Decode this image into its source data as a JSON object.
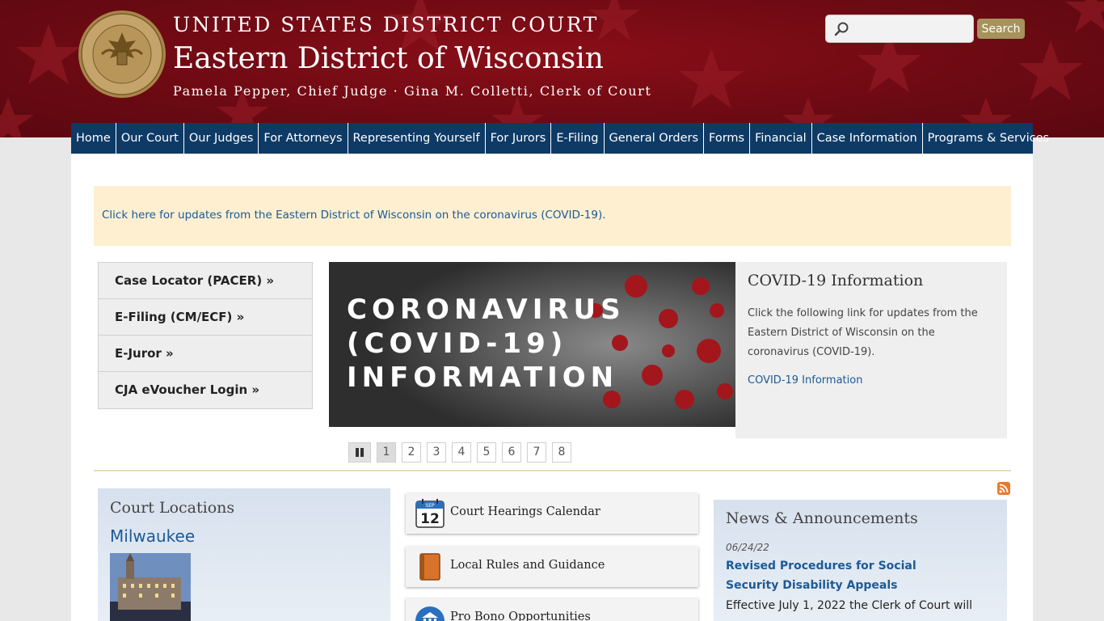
{
  "header": {
    "court": "UNITED STATES DISTRICT COURT",
    "district": "Eastern District of Wisconsin",
    "officers": "Pamela Pepper, Chief Judge · Gina M. Colletti, Clerk of Court",
    "seal_icon": "court-seal"
  },
  "search": {
    "placeholder": "",
    "value": "",
    "button_label": "Search"
  },
  "nav": {
    "items": [
      "Home",
      "Our Court",
      "Our Judges",
      "For Attorneys",
      "Representing Yourself",
      "For Jurors",
      "E-Filing",
      "General Orders",
      "Forms",
      "Financial",
      "Case Information",
      "Programs & Services"
    ]
  },
  "alert": {
    "link_text": "Click here for updates from the Eastern District of Wisconsin on the coronavirus (COVID-19)."
  },
  "quick_links": [
    "Case Locator (PACER) »",
    "E-Filing (CM/ECF) »",
    "E-Juror »",
    "CJA eVoucher Login »"
  ],
  "slideshow": {
    "image_text": [
      "CORONAVIRUS",
      "(COVID-19)",
      "INFORMATION"
    ],
    "caption_title": "COVID-19 Information",
    "caption_text": "Click the following link for updates from the Eastern District of Wisconsin on the coronavirus (COVID-19).",
    "caption_link": "COVID-19 Information",
    "pages": [
      "1",
      "2",
      "3",
      "4",
      "5",
      "6",
      "7",
      "8"
    ],
    "active_page": 1
  },
  "locations": {
    "title": "Court Locations",
    "city": "Milwaukee"
  },
  "features": [
    {
      "label": "Court Hearings Calendar",
      "icon": "calendar-icon",
      "month": "SEP",
      "day": "12"
    },
    {
      "label": "Local Rules and Guidance",
      "icon": "book-icon"
    },
    {
      "label": "Pro Bono Opportunities",
      "icon": "courthouse-icon"
    }
  ],
  "news": {
    "title": "News & Announcements",
    "date": "06/24/22",
    "headline": "Revised Procedures for Social Security Disability Appeals",
    "body": "Effective July 1, 2022 the Clerk of Court will"
  },
  "colors": {
    "header_red": "#6e0a13",
    "nav_blue": "#0e3a66",
    "link_blue": "#1c5a96",
    "search_gold": "#a5925c",
    "alert_bg": "#fdefd0"
  }
}
